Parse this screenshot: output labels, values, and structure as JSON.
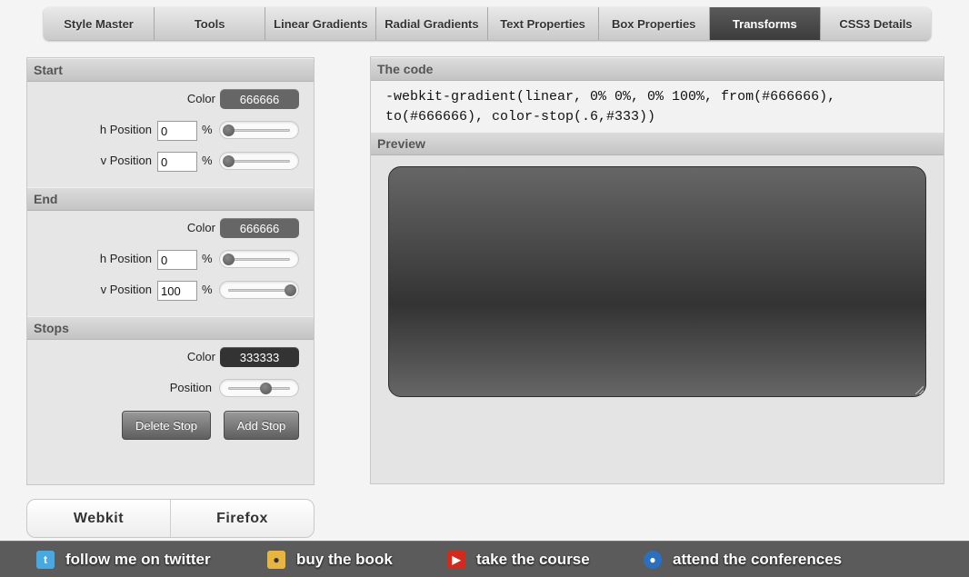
{
  "nav": {
    "tabs": [
      {
        "label": "Style Master"
      },
      {
        "label": "Tools"
      },
      {
        "label": "Linear Gradients"
      },
      {
        "label": "Radial Gradients"
      },
      {
        "label": "Text Properties"
      },
      {
        "label": "Box Properties"
      },
      {
        "label": "Transforms",
        "active": true
      },
      {
        "label": "CSS3 Details"
      }
    ]
  },
  "start": {
    "header": "Start",
    "color_label": "Color",
    "color_value": "666666",
    "h_label": "h Position",
    "h_value": "0",
    "v_label": "v Position",
    "v_value": "0",
    "unit": "%"
  },
  "end": {
    "header": "End",
    "color_label": "Color",
    "color_value": "666666",
    "h_label": "h Position",
    "h_value": "0",
    "v_label": "v Position",
    "v_value": "100",
    "unit": "%"
  },
  "stops": {
    "header": "Stops",
    "color_label": "Color",
    "color_value": "333333",
    "position_label": "Position",
    "position_fraction": 0.6,
    "delete_label": "Delete Stop",
    "add_label": "Add Stop"
  },
  "browser_toggle": {
    "webkit": "Webkit",
    "firefox": "Firefox"
  },
  "code_panel": {
    "header": "The code",
    "line1": "-webkit-gradient(linear, 0% 0%, 0% 100%, from(#666666),",
    "line2": "to(#666666), color-stop(.6,#333))"
  },
  "preview_panel": {
    "header": "Preview"
  },
  "colors": {
    "start": "#666666",
    "end": "#666666",
    "stop": "#333333",
    "active_tab": "#444444"
  },
  "footer": {
    "twitter": {
      "label": "follow me on twitter",
      "icon": "twitter-icon"
    },
    "book": {
      "label": "buy the book",
      "icon": "book-icon"
    },
    "course": {
      "label": "take the course",
      "icon": "youtube-icon"
    },
    "conferences": {
      "label": "attend the conferences",
      "icon": "globe-icon"
    }
  }
}
